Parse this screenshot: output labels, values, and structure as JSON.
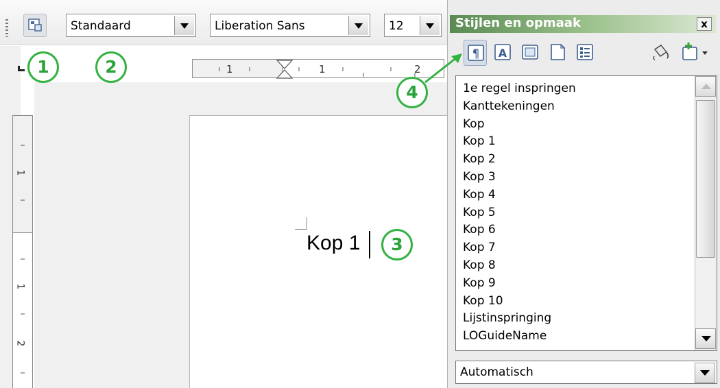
{
  "toolbar": {
    "paragraph_style": "Standaard",
    "font_name": "Liberation Sans",
    "font_size": "12"
  },
  "ruler": {
    "h_ticks": [
      "1",
      "1",
      "2"
    ],
    "v_ticks": [
      "1",
      "1",
      "2"
    ]
  },
  "document": {
    "text": "Kop 1"
  },
  "callouts": [
    "1",
    "2",
    "3",
    "4"
  ],
  "stylist": {
    "title": "Stijlen en opmaak",
    "close": "x",
    "styles": [
      "1e regel inspringen",
      "Kanttekeningen",
      "Kop",
      "Kop 1",
      "Kop 2",
      "Kop 3",
      "Kop 4",
      "Kop 5",
      "Kop 6",
      "Kop 7",
      "Kop 8",
      "Kop 9",
      "Kop 10",
      "Lijstinspringing",
      "LOGuideName"
    ],
    "filter": "Automatisch",
    "icons": [
      "paragraph-styles-icon",
      "character-styles-icon",
      "frame-styles-icon",
      "page-styles-icon",
      "list-styles-icon",
      "fill-format-icon",
      "new-style-icon"
    ]
  },
  "colors": {
    "callout": "#33b241",
    "title_bar": "#5a8a52"
  }
}
